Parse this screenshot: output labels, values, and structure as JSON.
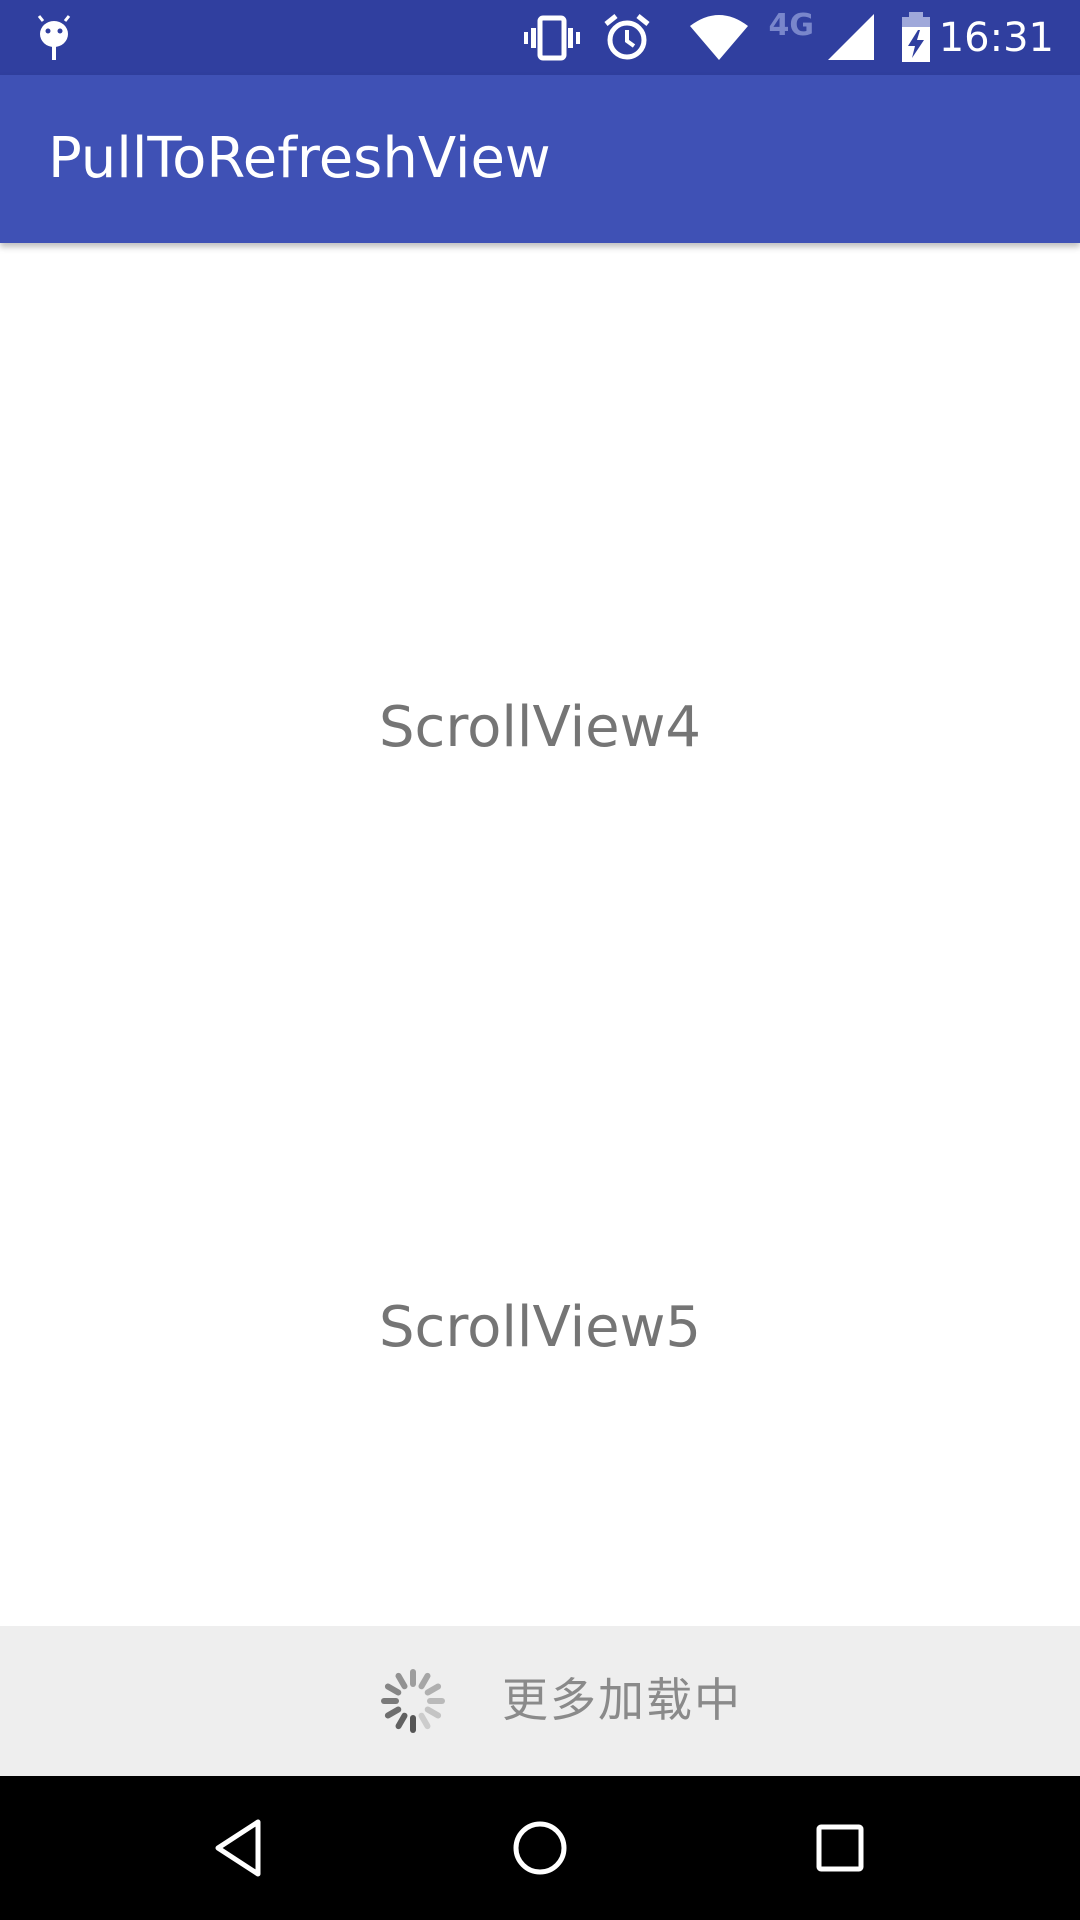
{
  "status_bar": {
    "time": "16:31",
    "network_label": "4G",
    "icons": [
      "android-debug-icon",
      "vibrate-icon",
      "alarm-icon",
      "wifi-icon",
      "cell-signal-icon",
      "battery-charging-icon"
    ],
    "background_color": "#303f9f"
  },
  "app_bar": {
    "title": "PullToRefreshView",
    "background_color": "#3f51b5"
  },
  "content": {
    "items": [
      {
        "label": "ScrollView4"
      },
      {
        "label": "ScrollView5"
      }
    ]
  },
  "load_more": {
    "text": "更多加载中",
    "icon": "loading-spinner-icon",
    "background_color": "#eeeeee"
  },
  "nav_bar": {
    "buttons": [
      "back-icon",
      "home-icon",
      "recent-apps-icon"
    ]
  }
}
